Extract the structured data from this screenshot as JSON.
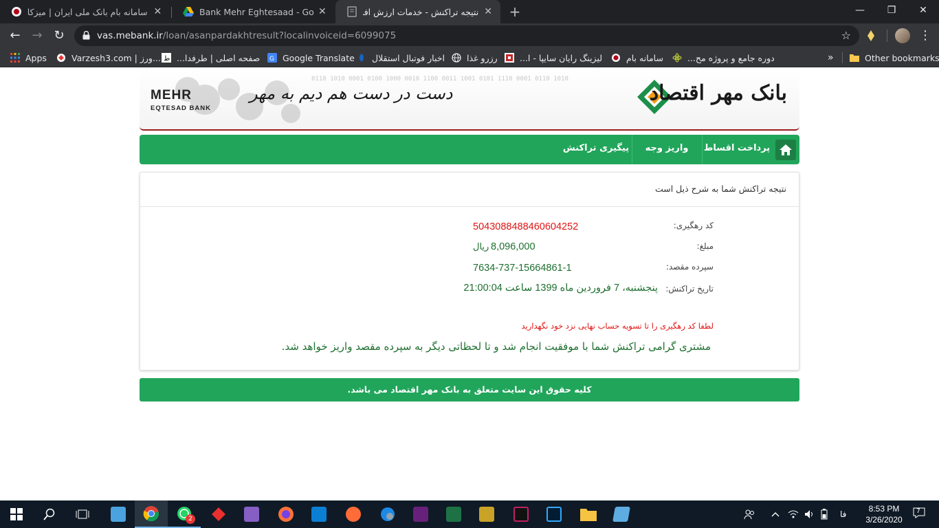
{
  "browser": {
    "tabs": [
      {
        "title": "سامانه بام بانک ملی ایران | میزکار",
        "close": "✕",
        "icon": "bank-melli-icon",
        "active": false
      },
      {
        "title": "Bank Mehr Eghtesaad - Google D",
        "close": "✕",
        "icon": "google-drive-icon",
        "active": false
      },
      {
        "title": "نتیجه تراکنش - خدمات ارزش افزوده",
        "close": "✕",
        "icon": "page-icon",
        "active": true
      }
    ],
    "new_tab": "+",
    "window_controls": {
      "minimize": "—",
      "maximize": "❐",
      "close": "✕"
    },
    "nav": {
      "back": "←",
      "forward": "→",
      "reload": "↻"
    },
    "url_host": "vas.mebank.ir",
    "url_rest": "/loan/asanpardakhtresult?localinvoiceid=6099075",
    "bookmark_star": "☆",
    "menu": "⋮"
  },
  "bookmarks": {
    "items": [
      {
        "label": "Apps",
        "icon": "apps-grid-icon"
      },
      {
        "label": "Varzesh3.com | ورز...",
        "icon": "varzesh3-icon"
      },
      {
        "label": "صفحه اصلی | طرفدا...",
        "icon": "tarafdari-icon"
      },
      {
        "label": "Google Translate",
        "icon": "google-translate-icon"
      },
      {
        "label": "اخبار فوتبال استقلال",
        "icon": "esteghlal-icon"
      },
      {
        "label": "رزرو غذا",
        "icon": "globe-icon"
      },
      {
        "label": "لیزینگ رایان سایپا - ا...",
        "icon": "leasing-icon"
      },
      {
        "label": "سامانه بام",
        "icon": "bank-melli-icon"
      },
      {
        "label": "دوره جامع و پروژه مح...",
        "icon": "atom-icon"
      }
    ],
    "overflow": "»",
    "other": "Other bookmarks"
  },
  "site": {
    "brand_en": "MEHR",
    "brand_en_sub": "EQTESAD BANK",
    "slogan": "دست در دست هم دیم به مهر",
    "bank_name": "بانک مهر اقتصاد",
    "nav": [
      {
        "label": "پرداخت اقساط"
      },
      {
        "label": "واریز وجه"
      },
      {
        "label": "پیگیری تراکنش"
      }
    ],
    "card": {
      "heading": "نتیجه تراکنش شما به شرح ذیل است",
      "fields": {
        "tracking_label": "کد رهگیری:",
        "tracking_value": "5043088488460604252",
        "amount_label": "مبلغ:",
        "amount_value": "8,096,000",
        "amount_unit": "ریال",
        "dest_label": "سپرده مقصد:",
        "dest_value": "7634-737-15664861-1",
        "date_label": "تاریخ تراکنش:",
        "date_value": "پنجشنبه، 7 فروردین ماه 1399 ساعت 21:00:04"
      },
      "warning": "لطفا کد رهگیری را تا تسویه حساب نهایی نزد خود نگهدارید",
      "success": "مشتری گرامی تراکنش شما با موفقیت انجام شد و تا لحظاتی دیگر به سپرده مقصد واریز خواهد شد."
    },
    "footer": "کلیه حقوق این سایت متعلق به بانک مهر اقتصاد می باشد.",
    "colors": {
      "green": "#21a55b",
      "dark_green_text": "#1e6f2f",
      "red": "#e01414"
    }
  },
  "taskbar": {
    "apps": [
      "start-icon",
      "search-icon",
      "task-view-icon",
      "file-explorer-alt-icon",
      "chrome-icon",
      "whatsapp-icon",
      "anydesk-icon",
      "visual-studio-icon",
      "firefox-icon",
      "vscode-icon",
      "postman-icon",
      "globe-app-icon",
      "visual-studio-2-icon",
      "excel-icon",
      "installer-icon",
      "rider-icon",
      "photoshop-icon",
      "folder-icon",
      "notepad-icon"
    ],
    "whatsapp_badge": "2",
    "lang": "فا",
    "time": "8:53 PM",
    "date": "3/26/2020",
    "notifications": "7"
  }
}
